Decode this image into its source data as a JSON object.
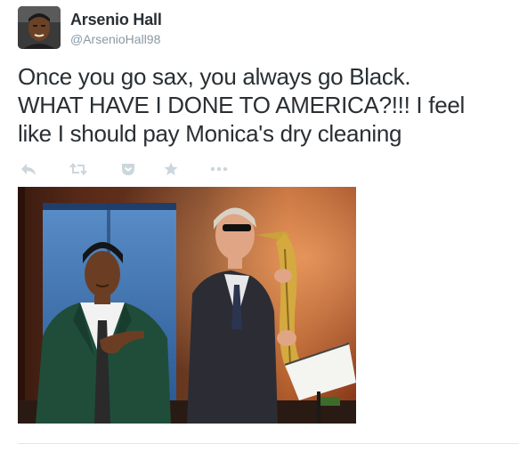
{
  "user": {
    "display_name": "Arsenio Hall",
    "handle": "@ArsenioHall98"
  },
  "tweet": {
    "text_line_1": "Once you go sax, you always go Black.",
    "text_line_2": "WHAT HAVE I DONE TO AMERICA?!!! I feel",
    "text_line_3": "like I should pay Monica's dry cleaning"
  },
  "actions": [
    {
      "name": "reply",
      "icon": "reply-icon"
    },
    {
      "name": "retweet",
      "icon": "retweet-icon"
    },
    {
      "name": "pocket",
      "icon": "pocket-icon"
    },
    {
      "name": "favorite",
      "icon": "star-icon"
    },
    {
      "name": "more",
      "icon": "more-dots-icon"
    }
  ],
  "colors": {
    "text": "#292f33",
    "muted": "#8899a6",
    "action_icon": "#ccd6dd",
    "divider": "#e1e8ed"
  }
}
